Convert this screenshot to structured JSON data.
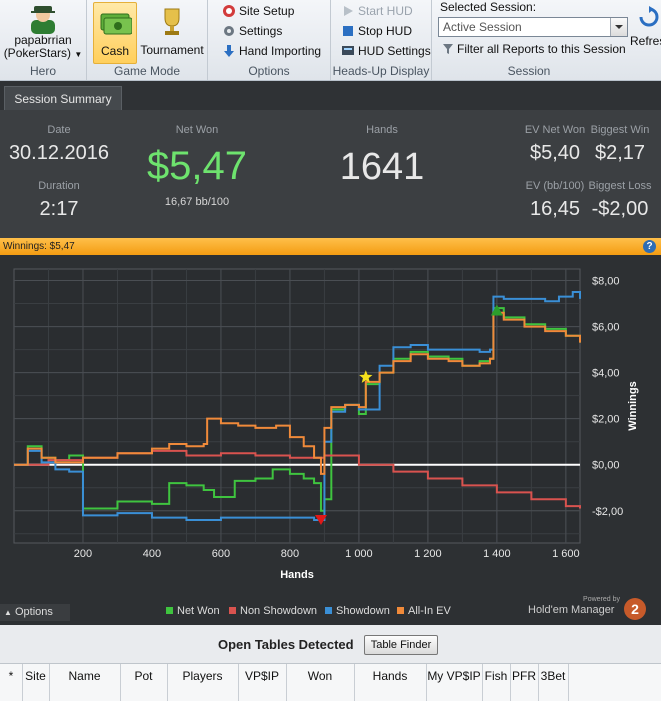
{
  "ribbon": {
    "hero": {
      "name": "papabrrian",
      "site": "(PokerStars)",
      "group_label": "Hero"
    },
    "game_mode": {
      "cash_label": "Cash",
      "tournament_label": "Tournament",
      "group_label": "Game Mode",
      "active": "Cash"
    },
    "options": {
      "site_setup": "Site Setup",
      "settings": "Settings",
      "hand_importing": "Hand Importing",
      "group_label": "Options"
    },
    "hud": {
      "start": "Start HUD",
      "stop": "Stop HUD",
      "settings": "HUD Settings",
      "group_label": "Heads-Up Display"
    },
    "session": {
      "label": "Selected Session:",
      "value": "Active Session",
      "filter": "Filter all Reports to this Session",
      "group_label": "Session",
      "refresh": "Refres"
    }
  },
  "tabs": [
    "Session Summary"
  ],
  "summary": {
    "date_label": "Date",
    "date": "30.12.2016",
    "duration_label": "Duration",
    "duration": "2:17",
    "net_won_label": "Net Won",
    "net_won": "$5,47",
    "net_won_bb": "16,67 bb/100",
    "hands_label": "Hands",
    "hands": "1641",
    "ev_net_won_label": "EV Net Won",
    "ev_net_won": "$5,40",
    "biggest_win_label": "Biggest Win",
    "biggest_win": "$2,17",
    "ev_bb_label": "EV (bb/100)",
    "ev_bb": "16,45",
    "biggest_loss_label": "Biggest Loss",
    "biggest_loss": "-$2,00"
  },
  "winnings_bar": "Winnings: $5,47",
  "colors": {
    "net_won": "#3fc43f",
    "non_showdown": "#d9534f",
    "showdown": "#3a8fd6",
    "allin_ev": "#f08a3a",
    "accent": "#f39c12",
    "net_won_text": "#6ee36e"
  },
  "chart_data": {
    "type": "line",
    "xlabel": "Hands",
    "ylabel": "Winnings",
    "xlim": [
      0,
      1641
    ],
    "ylim": [
      -3.4,
      8.5
    ],
    "x_ticks": [
      200,
      400,
      600,
      800,
      1000,
      1200,
      1400,
      1600
    ],
    "x_tick_labels": [
      "200",
      "400",
      "600",
      "800",
      "1 000",
      "1 200",
      "1 400",
      "1 600"
    ],
    "y_ticks": [
      -2,
      0,
      2,
      4,
      6,
      8
    ],
    "y_tick_labels": [
      "-$2,00",
      "$0,00",
      "$2,00",
      "$4,00",
      "$6,00",
      "$8,00"
    ],
    "grid": true,
    "legend_position": "bottom",
    "series": [
      {
        "name": "Net Won",
        "color": "#3fc43f",
        "x": [
          0,
          40,
          80,
          120,
          160,
          200,
          300,
          400,
          450,
          500,
          550,
          580,
          640,
          700,
          750,
          800,
          840,
          870,
          890,
          900,
          920,
          960,
          1000,
          1020,
          1060,
          1100,
          1150,
          1200,
          1260,
          1300,
          1350,
          1380,
          1390,
          1420,
          1480,
          1540,
          1600,
          1641
        ],
        "y": [
          0,
          0.8,
          0.3,
          0.2,
          0.4,
          -1.9,
          -1.6,
          -1.7,
          -0.8,
          -0.9,
          -1.1,
          -1.4,
          -0.7,
          -0.6,
          -0.2,
          -0.4,
          -0.6,
          -0.8,
          -2.0,
          -1.5,
          2.4,
          2.6,
          2.2,
          3.5,
          4.0,
          4.6,
          4.9,
          4.7,
          4.6,
          4.3,
          4.5,
          4.6,
          6.8,
          6.4,
          6.1,
          5.9,
          5.6,
          5.3
        ]
      },
      {
        "name": "Non Showdown",
        "color": "#d9534f",
        "x": [
          0,
          100,
          200,
          300,
          400,
          500,
          600,
          700,
          800,
          900,
          1000,
          1100,
          1200,
          1300,
          1400,
          1500,
          1600,
          1641
        ],
        "y": [
          0,
          0.2,
          0.3,
          0.5,
          0.6,
          0.4,
          0.5,
          0.4,
          0.3,
          0.4,
          0.0,
          -0.3,
          -0.6,
          -0.9,
          -1.2,
          -1.5,
          -1.8,
          -1.9
        ]
      },
      {
        "name": "Showdown",
        "color": "#3a8fd6",
        "x": [
          0,
          40,
          80,
          120,
          160,
          200,
          300,
          400,
          500,
          600,
          700,
          800,
          870,
          890,
          900,
          920,
          960,
          1000,
          1060,
          1100,
          1150,
          1200,
          1300,
          1350,
          1380,
          1390,
          1420,
          1480,
          1540,
          1580,
          1620,
          1641
        ],
        "y": [
          0,
          0.6,
          0.1,
          -0.2,
          -0.3,
          -2.2,
          -2.1,
          -2.3,
          -2.4,
          -2.3,
          -2.3,
          -2.3,
          -2.4,
          -2.4,
          1.0,
          2.3,
          2.6,
          2.4,
          4.3,
          5.1,
          5.2,
          5.0,
          5.0,
          4.9,
          5.0,
          7.3,
          7.2,
          7.2,
          7.1,
          7.3,
          7.5,
          7.2
        ]
      },
      {
        "name": "All-In EV",
        "color": "#f08a3a",
        "x": [
          0,
          40,
          80,
          120,
          200,
          300,
          400,
          450,
          500,
          550,
          560,
          600,
          650,
          700,
          760,
          800,
          840,
          870,
          890,
          900,
          920,
          960,
          1000,
          1020,
          1060,
          1100,
          1150,
          1200,
          1260,
          1300,
          1350,
          1380,
          1390,
          1420,
          1480,
          1540,
          1600,
          1641
        ],
        "y": [
          0,
          0.7,
          0.3,
          0.1,
          0.3,
          0.5,
          0.7,
          0.9,
          0.8,
          0.9,
          2.0,
          1.8,
          1.7,
          1.6,
          1.7,
          1.2,
          0.8,
          0.3,
          -0.4,
          1.6,
          2.5,
          2.6,
          2.5,
          3.6,
          4.0,
          4.5,
          4.8,
          4.6,
          4.5,
          4.3,
          4.4,
          4.6,
          6.6,
          6.3,
          6.0,
          5.8,
          5.6,
          5.3
        ]
      }
    ],
    "markers": [
      {
        "name": "lowest-point-marker",
        "shape": "triangle-down",
        "color": "#e01818",
        "x": 890,
        "y": -2.4
      },
      {
        "name": "star-marker",
        "shape": "star",
        "color": "#f5e01c",
        "x": 1020,
        "y": 3.8
      },
      {
        "name": "highest-point-marker",
        "shape": "triangle-up",
        "color": "#2c9e2c",
        "x": 1400,
        "y": 6.7
      }
    ]
  },
  "chart_footer": {
    "options_label": "Options",
    "powered_by": "Powered by",
    "logo_text": "Hold'em Manager",
    "logo_badge": "2"
  },
  "open_tables": {
    "title": "Open Tables Detected",
    "finder_button": "Table Finder",
    "columns": [
      "*",
      "Site",
      "Name",
      "Pot",
      "Players",
      "VP$IP",
      "Won",
      "Hands",
      "My VP$IP",
      "Fish",
      "PFR",
      "3Bet"
    ]
  }
}
